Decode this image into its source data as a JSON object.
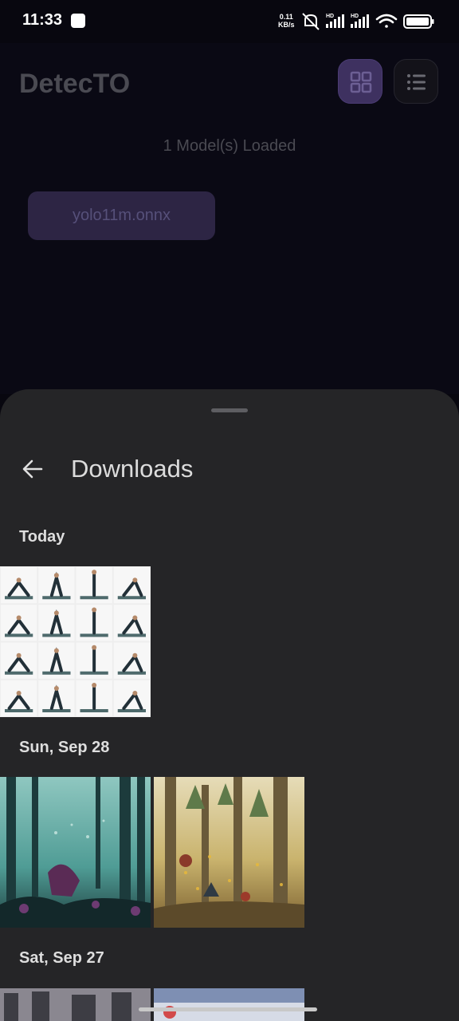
{
  "status_bar": {
    "time": "11:33",
    "net_speed_value": "0.11",
    "net_speed_unit": "KB/s",
    "icons": [
      "notification-icon",
      "mute-icon",
      "signal-hd-icon",
      "signal-hd-icon",
      "wifi-icon",
      "battery-icon"
    ]
  },
  "app": {
    "title": "DetecTO",
    "models_loaded": "1 Model(s) Loaded",
    "model_chip": "yolo11m.onnx",
    "accent_color": "#3e3160"
  },
  "picker": {
    "title": "Downloads",
    "sections": [
      {
        "label": "Today",
        "items": [
          "yoga-poses-grid-image"
        ]
      },
      {
        "label": "Sun, Sep 28",
        "items": [
          "teal-forest-illustration",
          "autumn-forest-illustration"
        ]
      },
      {
        "label": "Sat, Sep 27",
        "items": [
          "street-photo",
          "ui-screenshot"
        ]
      }
    ]
  }
}
